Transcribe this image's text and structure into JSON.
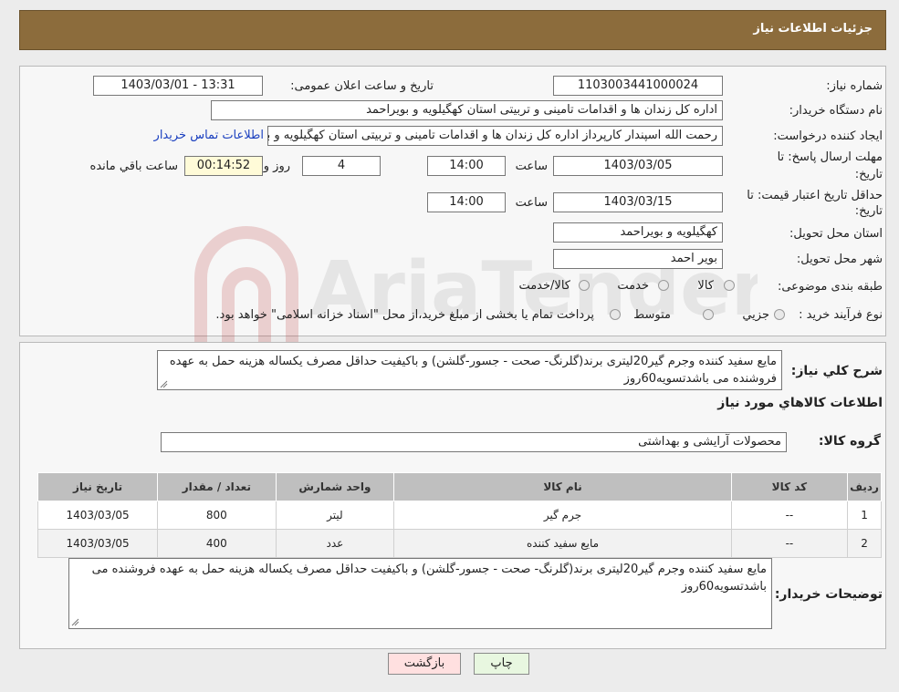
{
  "header": {
    "title": "جزئیات اطلاعات نیاز"
  },
  "details": {
    "need_number_label": "شماره نیاز:",
    "need_number": "1103003441000024",
    "announce_label": "تاریخ و ساعت اعلان عمومی:",
    "announce_value": "1403/03/01 - 13:31",
    "buyer_org_label": "نام دستگاه خریدار:",
    "buyer_org": "اداره کل زندان ها و اقدامات تامینی و تربیتی استان کهگیلویه و بویراحمد",
    "creator_label": "ایجاد کننده درخواست:",
    "creator": "رحمت الله اسپندار کارپرداز اداره کل زندان ها و اقدامات تامینی و تربیتی استان کهگیلویه و بویراحمد",
    "contact_link": "اطلاعات تماس خریدار",
    "deadline_label_1": "مهلت ارسال پاسخ: تا",
    "deadline_label_2": "تاریخ:",
    "deadline_date": "1403/03/05",
    "time_label": "ساعت",
    "deadline_time": "14:00",
    "days_value": "4",
    "days_label": "روز و",
    "remaining_time": "00:14:52",
    "remaining_label": "ساعت باقي مانده",
    "validity_label_1": "حداقل تاریخ اعتبار قیمت: تا",
    "validity_label_2": "تاریخ:",
    "validity_date": "1403/03/15",
    "validity_time": "14:00",
    "province_label": "استان محل تحویل:",
    "province": "کهگیلویه و بویراحمد",
    "city_label": "شهر محل تحویل:",
    "city": "بویر احمد",
    "category_label": "طبقه بندی موضوعی:",
    "category_options": [
      "کالا",
      "خدمت",
      "کالا/خدمت"
    ],
    "process_label": "نوع فرآیند خرید :",
    "process_options": [
      "جزيي",
      "متوسط"
    ],
    "process_note": "پرداخت تمام یا بخشی از مبلغ خرید،از محل \"اسناد خزانه اسلامی\" خواهد بود."
  },
  "summary": {
    "label": "شرح کلي نياز:",
    "text": "مایع سفید کننده وجرم گیر20لیتری  برند(گلرنگ- صحت - جسور-گلشن) و باکیفیت حداقل مصرف یکساله هزینه حمل به عهده فروشنده می باشدتسویه60روز"
  },
  "items_section": {
    "title": "اطلاعات کالاهاي مورد نياز",
    "group_label": "گروه کالا:",
    "group_value": "محصولات آرایشی و بهداشتی"
  },
  "table": {
    "headers": [
      "رديف",
      "کد کالا",
      "نام کالا",
      "واحد شمارش",
      "تعداد / مقدار",
      "تاریخ نیاز"
    ],
    "rows": [
      [
        "1",
        "--",
        "جرم گیر",
        "لیتر",
        "800",
        "1403/03/05"
      ],
      [
        "2",
        "--",
        "مایع سفید کننده",
        "عدد",
        "400",
        "1403/03/05"
      ]
    ]
  },
  "buyer_notes": {
    "label": "توضیحات خریدار:",
    "text": "مایع سفید کننده وجرم گیر20لیتری  برند(گلرنگ- صحت - جسور-گلشن) و باکیفیت حداقل مصرف یکساله هزینه حمل به عهده فروشنده می باشدتسویه60روز"
  },
  "buttons": {
    "print": "چاپ",
    "back": "بازگشت"
  },
  "watermark": {
    "text": "AriaTender.neT"
  },
  "colors": {
    "header_bg": "#8c6c3c",
    "back_button_bg": "#ffe0e0",
    "print_button_bg": "#e8f7e0",
    "link": "#1a3fbf"
  }
}
